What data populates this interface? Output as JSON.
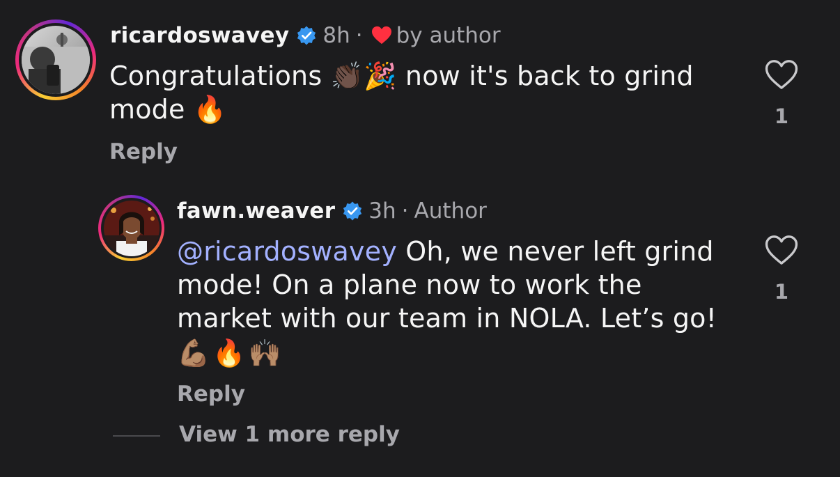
{
  "comments": [
    {
      "username": "ricardoswavey",
      "time": "8h",
      "separator": "·",
      "liked_by": "by author",
      "text_parts": [
        "Congratulations ",
        "👏🏿🎉",
        " now it's back to grind mode ",
        "🔥"
      ],
      "reply_label": "Reply",
      "like_count": "1"
    },
    {
      "username": "fawn.weaver",
      "time": "3h",
      "separator": "·",
      "role": "Author",
      "mention": "@ricardoswavey",
      "text": " Oh, we never left grind mode! On a plane now to work the market with our team in NOLA. Let’s go!",
      "emojis": "💪🏽🔥🙌🏽",
      "reply_label": "Reply",
      "like_count": "1"
    }
  ],
  "view_more": "View 1 more reply",
  "colors": {
    "background": "#1c1c1e",
    "verified": "#3897f0",
    "heart": "#ff3040",
    "mention": "#a3b1ff",
    "muted": "#a8a8ad"
  },
  "icons": [
    "verified-badge-icon",
    "heart-filled-icon",
    "heart-outline-icon"
  ]
}
